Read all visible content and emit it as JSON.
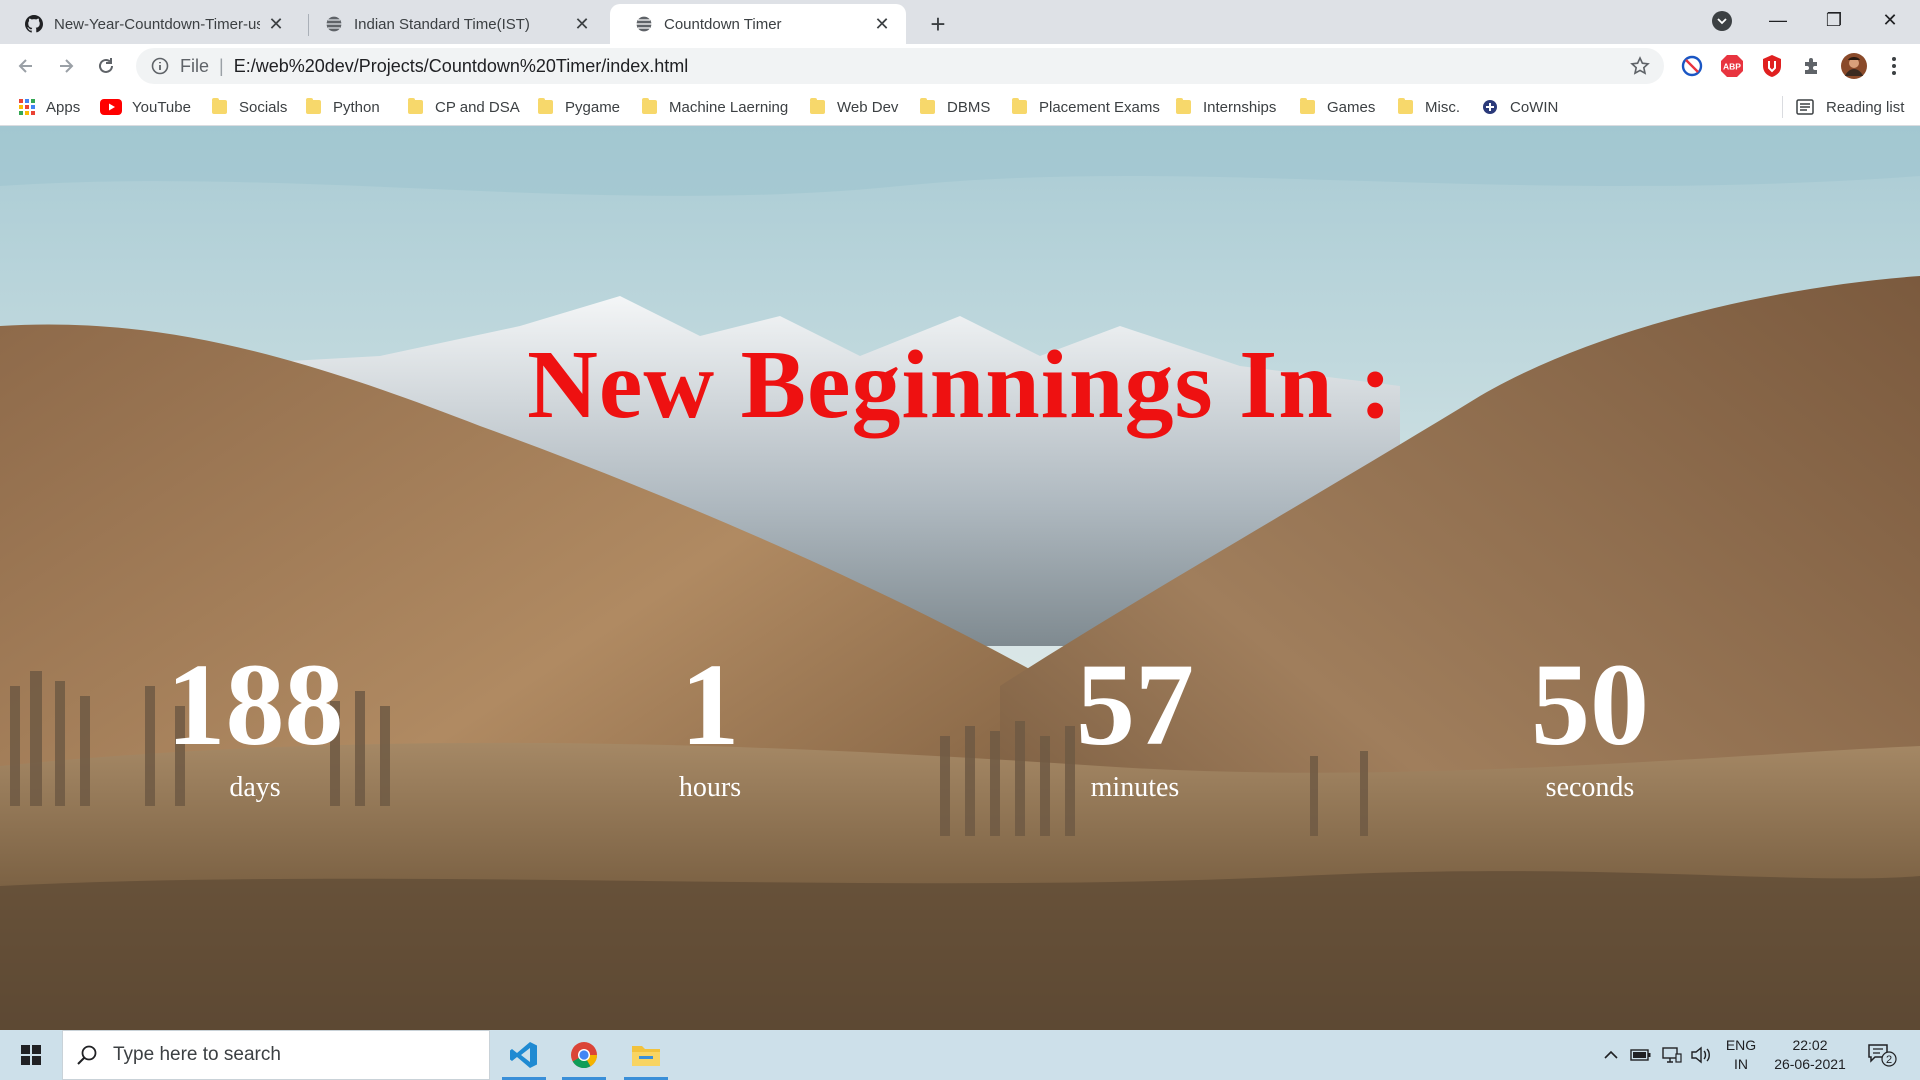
{
  "browser": {
    "tabs": [
      {
        "title": "New-Year-Countdown-Timer-usi",
        "favicon": "github-icon",
        "active": false
      },
      {
        "title": "Indian Standard Time(IST)",
        "favicon": "globe-icon",
        "active": false
      },
      {
        "title": "Countdown Timer",
        "favicon": "globe-icon",
        "active": true
      }
    ],
    "new_tab": "+",
    "window_controls": {
      "minimize": "—",
      "maximize": "❐",
      "close": "✕"
    },
    "address": {
      "scheme": "File",
      "url": "E:/web%20dev/Projects/Countdown%20Timer/index.html"
    },
    "extensions": [
      {
        "icon": "block-icon",
        "color": "#1a56c4"
      },
      {
        "icon": "adblock-plus-icon",
        "text": "ABP",
        "color": "#e8343f"
      },
      {
        "icon": "shield-icon",
        "color": "#e02020"
      },
      {
        "icon": "puzzle-icon",
        "color": "#5f6368"
      },
      {
        "icon": "avatar",
        "color": "#8a4a2a"
      }
    ],
    "bookmarks": [
      {
        "label": "Apps",
        "icon": "apps-grid-icon"
      },
      {
        "label": "YouTube",
        "icon": "youtube-icon"
      },
      {
        "label": "Socials",
        "icon": "folder-icon"
      },
      {
        "label": "Python",
        "icon": "folder-icon"
      },
      {
        "label": "CP and DSA",
        "icon": "folder-icon"
      },
      {
        "label": "Pygame",
        "icon": "folder-icon"
      },
      {
        "label": "Machine Laerning",
        "icon": "folder-icon"
      },
      {
        "label": "Web Dev",
        "icon": "folder-icon"
      },
      {
        "label": "DBMS",
        "icon": "folder-icon"
      },
      {
        "label": "Placement Exams",
        "icon": "folder-icon"
      },
      {
        "label": "Internships",
        "icon": "folder-icon"
      },
      {
        "label": "Games",
        "icon": "folder-icon"
      },
      {
        "label": "Misc.",
        "icon": "folder-icon"
      },
      {
        "label": "CoWIN",
        "icon": "cowin-icon"
      }
    ],
    "reading_list": "Reading list"
  },
  "page": {
    "heading": "New Beginnings In :",
    "heading_color": "#ee1111",
    "countdown": [
      {
        "value": "188",
        "label": "days"
      },
      {
        "value": "1",
        "label": "hours"
      },
      {
        "value": "57",
        "label": "minutes"
      },
      {
        "value": "50",
        "label": "seconds"
      }
    ]
  },
  "taskbar": {
    "search_placeholder": "Type here to search",
    "apps": [
      {
        "name": "vscode-icon",
        "color": "#1f8ad2"
      },
      {
        "name": "chrome-icon",
        "color": "#db4437"
      },
      {
        "name": "file-explorer-icon",
        "color": "#f2c23c"
      }
    ],
    "language": {
      "line1": "ENG",
      "line2": "IN"
    },
    "clock": {
      "time": "22:02",
      "date": "26-06-2021"
    },
    "notification_count": "2"
  }
}
